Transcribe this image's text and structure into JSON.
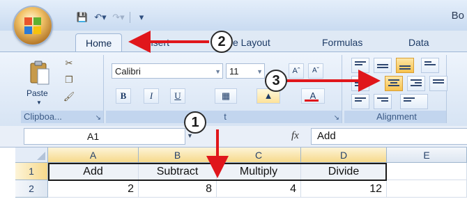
{
  "window": {
    "title": "Bo"
  },
  "quick_access": {
    "icons": [
      "save-icon",
      "undo-icon",
      "redo-icon",
      "customize-icon"
    ]
  },
  "tabs": [
    {
      "label": "Home",
      "active": true
    },
    {
      "label": "Insert"
    },
    {
      "label": "e Layout"
    },
    {
      "label": "Formulas"
    },
    {
      "label": "Data"
    }
  ],
  "ribbon": {
    "clipboard": {
      "paste_label": "Paste",
      "group_label": "Clipboa..."
    },
    "font": {
      "font_name": "Calibri",
      "font_size": "11",
      "bold": "B",
      "italic": "I",
      "underline": "U",
      "color_letter": "A",
      "group_label": "t"
    },
    "alignment": {
      "group_label": "Alignment"
    }
  },
  "formula_bar": {
    "name_box": "A1",
    "fx_label": "fx",
    "value": "Add"
  },
  "sheet": {
    "columns": [
      "A",
      "B",
      "C",
      "D",
      "E"
    ],
    "rows": [
      {
        "num": "1",
        "cells": [
          "Add",
          "Subtract",
          "Multiply",
          "Divide",
          ""
        ]
      },
      {
        "num": "2",
        "cells": [
          "2",
          "8",
          "4",
          "12",
          ""
        ]
      }
    ]
  },
  "callouts": [
    "1",
    "2",
    "3"
  ],
  "colors": {
    "accent": "#f6d98b",
    "ribbon": "#dfe9f5",
    "arrow": "#e0161b"
  }
}
